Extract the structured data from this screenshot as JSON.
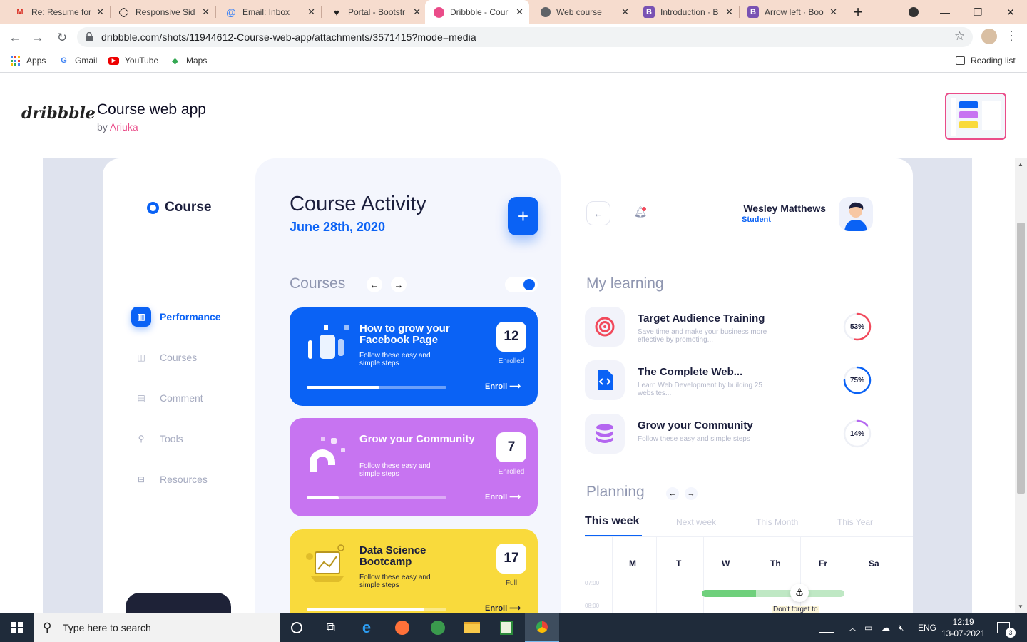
{
  "browser": {
    "tabs": [
      {
        "label": "Re: Resume for",
        "icon": "gmail-icon",
        "color": "#d93025"
      },
      {
        "label": "Responsive Side",
        "icon": "codepen-icon",
        "color": "#222222"
      },
      {
        "label": "Email: Inbox",
        "icon": "email-icon",
        "color": "#4285f4"
      },
      {
        "label": "Portal - Bootstr",
        "icon": "heart-icon",
        "color": "#222222"
      },
      {
        "label": "Dribbble - Cour",
        "icon": "dribbble-icon",
        "color": "#ea4c89"
      },
      {
        "label": "Web course",
        "icon": "globe-icon",
        "color": "#5f6368"
      },
      {
        "label": "Introduction · B",
        "icon": "bootstrap-icon",
        "color": "#7952b3"
      },
      {
        "label": "Arrow left · Boo",
        "icon": "bootstrap-icon",
        "color": "#7952b3"
      }
    ],
    "url": "dribbble.com/shots/11944612-Course-web-app/attachments/3571415?mode=media",
    "bookmarks": [
      "Apps",
      "Gmail",
      "YouTube",
      "Maps"
    ],
    "reading_list": "Reading list"
  },
  "shot": {
    "logo": "dribbble",
    "title": "Course web app",
    "by_prefix": "by",
    "author": "Ariuka"
  },
  "app": {
    "brand": "Course",
    "nav": [
      "Performance",
      "Courses",
      "Comment",
      "Tools",
      "Resources"
    ],
    "activity_title": "Course Activity",
    "activity_date": "June 28th, 2020",
    "courses_heading": "Courses",
    "cards": [
      {
        "title": "How to grow your Facebook Page",
        "subtitle": "Follow these easy and simple steps",
        "count": "12",
        "status": "Enrolled",
        "enroll": "Enroll",
        "progress": 0.52,
        "color": "#0a62f5"
      },
      {
        "title": "Grow your Community",
        "subtitle": "Follow these easy and simple steps",
        "count": "7",
        "status": "Enrolled",
        "enroll": "Enroll",
        "progress": 0.23,
        "color": "#c774f1"
      },
      {
        "title": "Data Science Bootcamp",
        "subtitle": "Follow these easy and simple steps",
        "count": "17",
        "status": "Full",
        "enroll": "Enroll",
        "progress": 0.84,
        "color": "#f9da3c"
      }
    ],
    "user_name": "Wesley Matthews",
    "user_role": "Student",
    "my_learning_heading": "My learning",
    "learning": [
      {
        "title": "Target Audience Training",
        "desc": "Save time and make your business more effective by promoting...",
        "percent": "53%",
        "progress": 0.53,
        "color": "#f2495b"
      },
      {
        "title": "The Complete Web...",
        "desc": "Learn Web Development by building 25 websites...",
        "percent": "75%",
        "progress": 0.75,
        "color": "#0a62f5"
      },
      {
        "title": "Grow your Community",
        "desc": "Follow these easy and simple steps",
        "percent": "14%",
        "progress": 0.14,
        "color": "#b466f0"
      }
    ],
    "planning_heading": "Planning",
    "plan_tabs": [
      "This week",
      "Next week",
      "This Month",
      "This Year"
    ],
    "days": [
      "M",
      "T",
      "W",
      "Th",
      "Fr",
      "Sa"
    ],
    "times": [
      "07:00",
      "08:00"
    ],
    "event_text": "Don't forget to"
  },
  "taskbar": {
    "search_placeholder": "Type here to search",
    "lang": "ENG",
    "time": "12:19",
    "date": "13-07-2021",
    "notif_count": "3"
  }
}
